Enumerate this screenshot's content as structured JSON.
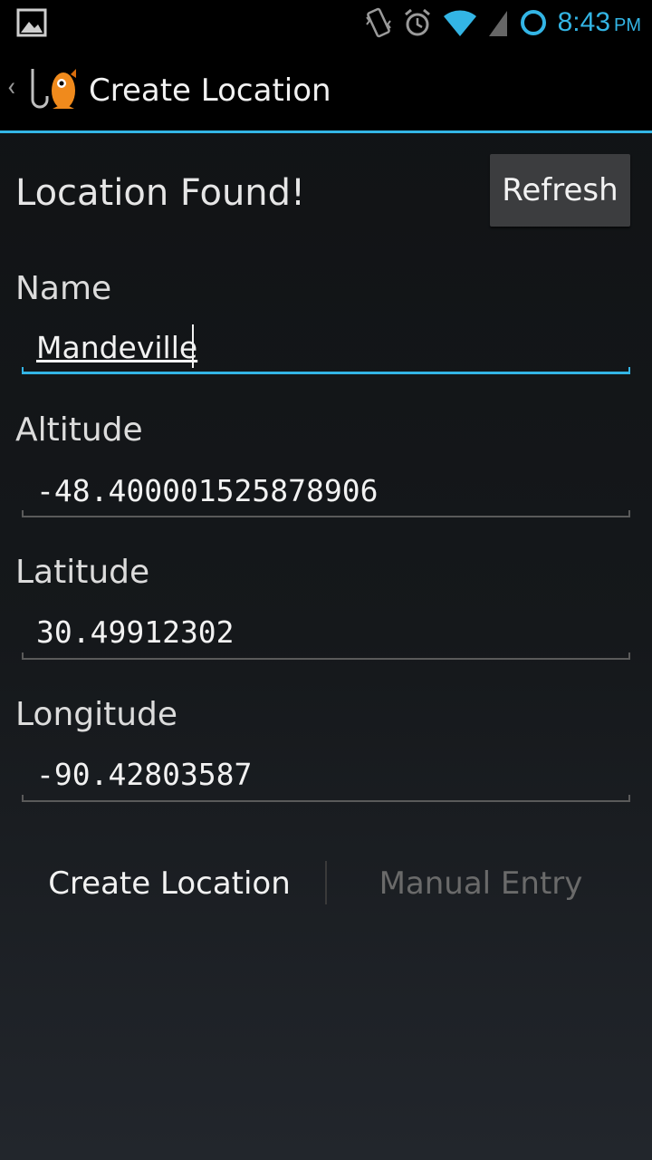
{
  "status_bar": {
    "time": "8:43",
    "ampm": "PM",
    "icons": [
      "picture-notification-icon",
      "vibrate-icon",
      "alarm-icon",
      "wifi-icon",
      "signal-icon",
      "sync-icon"
    ],
    "accent_color": "#33b5e5"
  },
  "action_bar": {
    "title": "Create Location",
    "up_indicator": "‹"
  },
  "main": {
    "status_text": "Location Found!",
    "refresh_label": "Refresh",
    "fields": {
      "name": {
        "label": "Name",
        "value": "Mandeville"
      },
      "altitude": {
        "label": "Altitude",
        "value": "-48.400001525878906"
      },
      "latitude": {
        "label": "Latitude",
        "value": "30.49912302"
      },
      "longitude": {
        "label": "Longitude",
        "value": "-90.42803587"
      }
    },
    "create_label": "Create Location",
    "manual_label": "Manual Entry"
  }
}
